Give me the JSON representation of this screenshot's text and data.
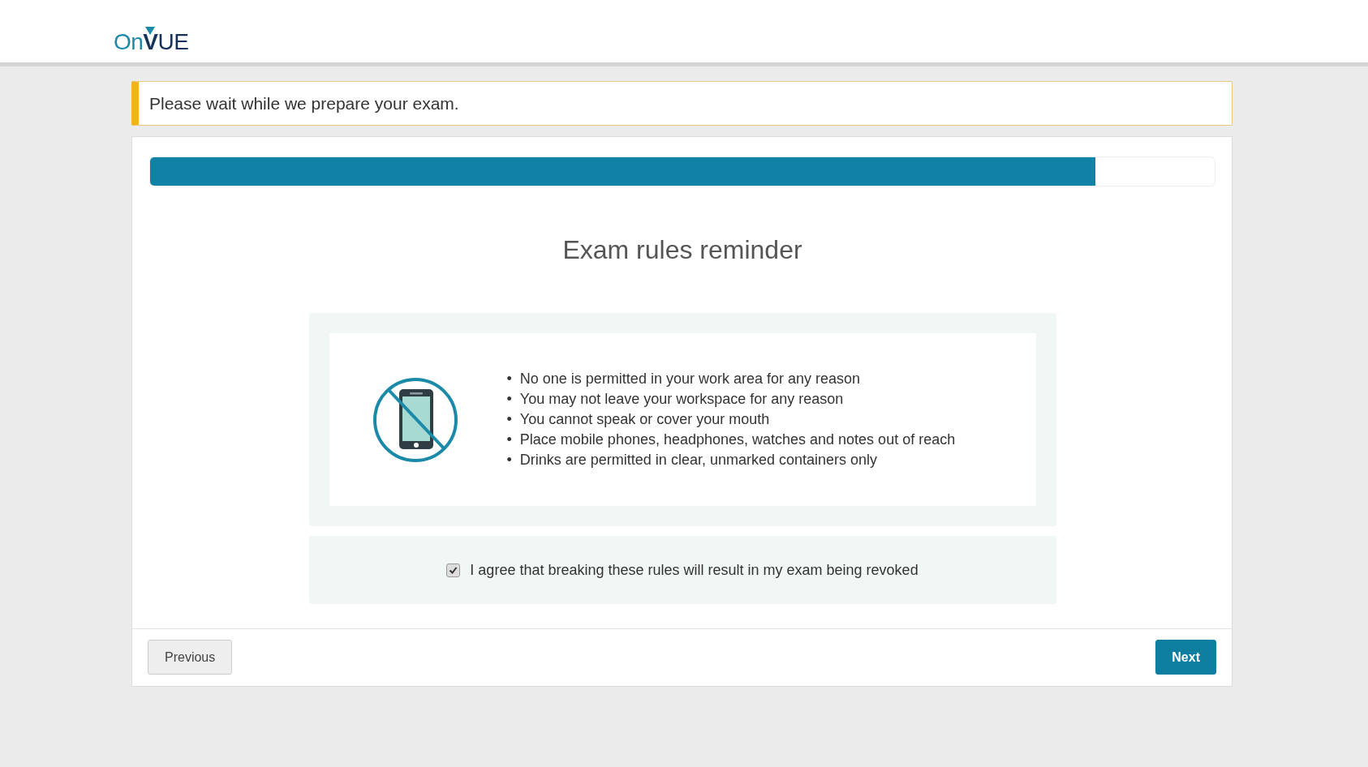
{
  "logo": {
    "parts": [
      "On",
      "V",
      "UE"
    ]
  },
  "alert": {
    "text": "Please wait while we prepare your exam."
  },
  "progress": {
    "level": 0.888
  },
  "title": "Exam rules reminder",
  "rules": [
    {
      "bullet": "•",
      "text": "No one is permitted in your work area for any reason"
    },
    {
      "bullet": "•",
      "text": "You may not leave your workspace for any reason"
    },
    {
      "bullet": "•",
      "text": "You cannot speak or cover your mouth"
    },
    {
      "bullet": "•",
      "text": "Place mobile phones, headphones, watches and notes out of reach"
    },
    {
      "bullet": "•",
      "text": "Drinks are permitted in clear, unmarked containers only"
    }
  ],
  "agreement": {
    "label": "I agree that breaking these rules will result in my exam being revoked",
    "checked": true
  },
  "buttons": {
    "previous": "Previous",
    "next": "Next"
  }
}
